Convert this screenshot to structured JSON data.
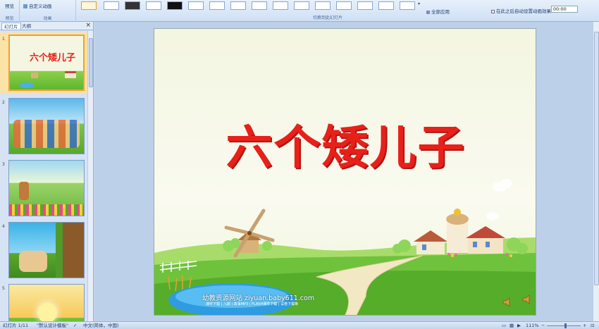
{
  "ribbon": {
    "preview_label": "预览",
    "custom_animation": "自定义动画",
    "group_preview": "预览",
    "group_animation": "动画",
    "group_transition": "切换到此幻灯片",
    "apply_all": "全部应用",
    "auto_after": "在此之后自动设置动画效果:",
    "auto_time": "00:00"
  },
  "pane": {
    "tab_slides": "幻灯片",
    "tab_outline": "大纲",
    "close": "×",
    "slide_numbers": [
      "1",
      "2",
      "3",
      "4",
      "5"
    ]
  },
  "slide": {
    "title": "六个矮儿子",
    "site_text": "幼教资源网站 ziyuan.baby611.com",
    "site_sub": "课件下载 | 儿歌 | 故事MP3 | FLASH课件下载 | 试卷下载等"
  },
  "thumb_title": "六个矮儿子",
  "status": {
    "slide_pos": "幻灯片 1/11",
    "theme": "\"默认设计模板\"",
    "lang": "中文(简体，中国)",
    "zoom": "111%"
  },
  "colors": {
    "title_red": "#e8201a",
    "ribbon_bg": "#dbe7f6",
    "active_orange": "#f0a030"
  }
}
